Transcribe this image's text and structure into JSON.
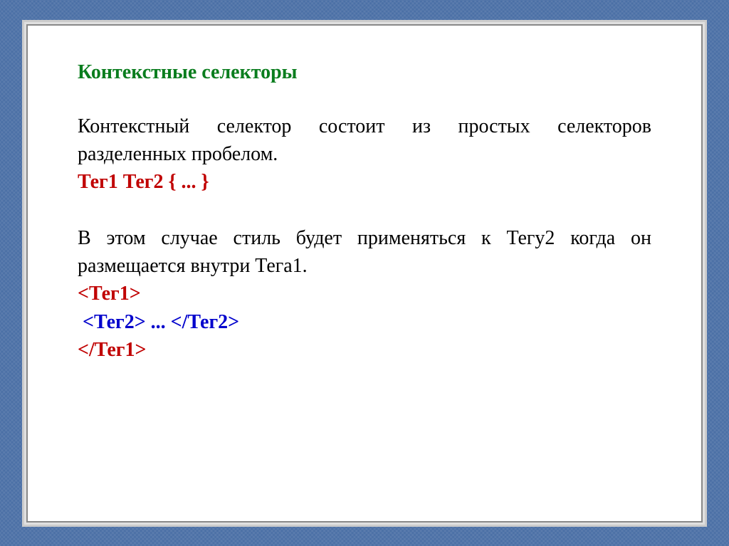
{
  "slide": {
    "title": "Контекстные селекторы",
    "paragraph1": "Контекстный селектор состоит из простых селекторов разделенных пробелом.",
    "syntax": "Тег1 Тег2 { ... }",
    "paragraph2": "В этом случае стиль будет применяться к Тегу2 когда он размещается внутри Тега1.",
    "tag1_open": "<Тег1>",
    "tag2_open": "<Тег2>",
    "ellipsis": " ... ",
    "tag2_close": "</Тег2>",
    "tag1_close": "</Тег1>"
  }
}
